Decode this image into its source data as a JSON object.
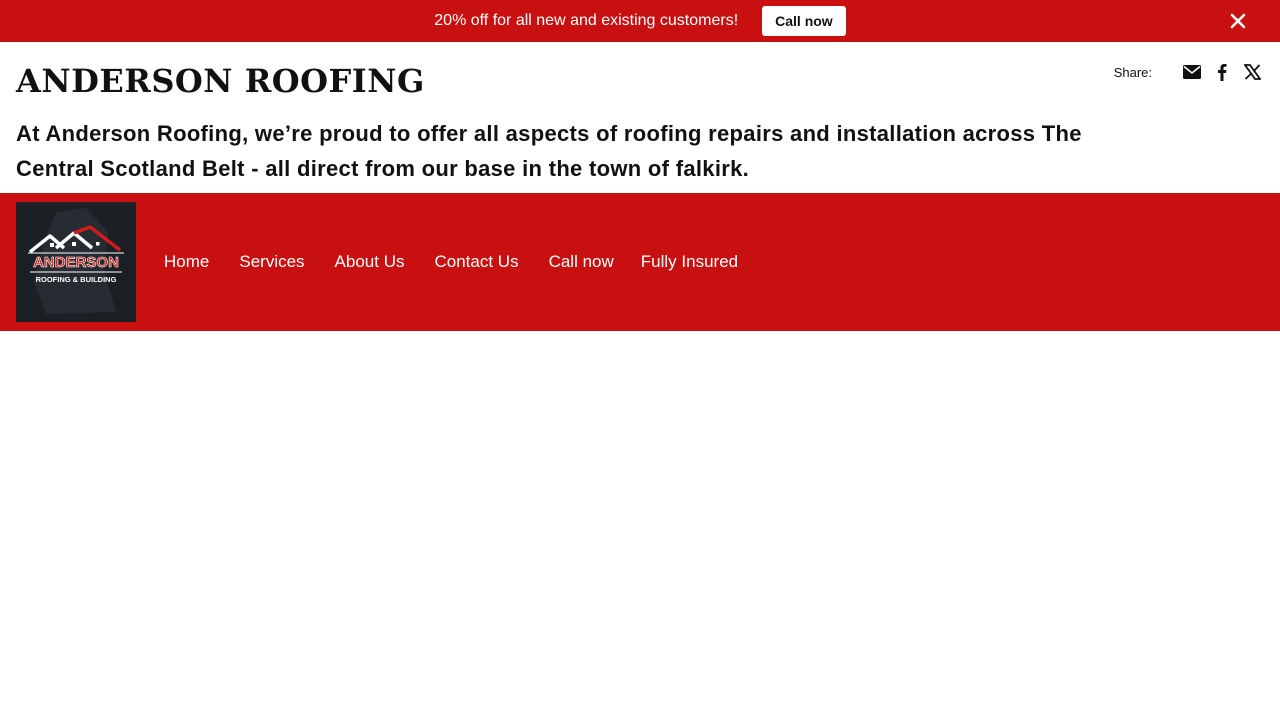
{
  "promo": {
    "text": "20% off for all new and existing customers!",
    "cta_label": "Call now",
    "close_icon": "close-icon"
  },
  "header": {
    "title": "ANDERSON ROOFING",
    "tagline": "At Anderson Roofing, we’re proud to offer all aspects of roofing repairs and installation across The Central Scotland Belt - all direct from our base in the town of falkirk."
  },
  "share": {
    "label": "Share:",
    "icons": [
      "envelope-icon",
      "facebook-icon",
      "x-icon"
    ]
  },
  "logo": {
    "line1": "ANDERSON",
    "line2": "ROOFING & BUILDING"
  },
  "nav": {
    "items": [
      "Home",
      "Services",
      "About Us",
      "Contact Us",
      "Call now",
      "Fully Insured"
    ]
  },
  "colors": {
    "brand_red": "#c91010",
    "logo_bg": "#1c2024",
    "text": "#111111",
    "white": "#ffffff"
  }
}
